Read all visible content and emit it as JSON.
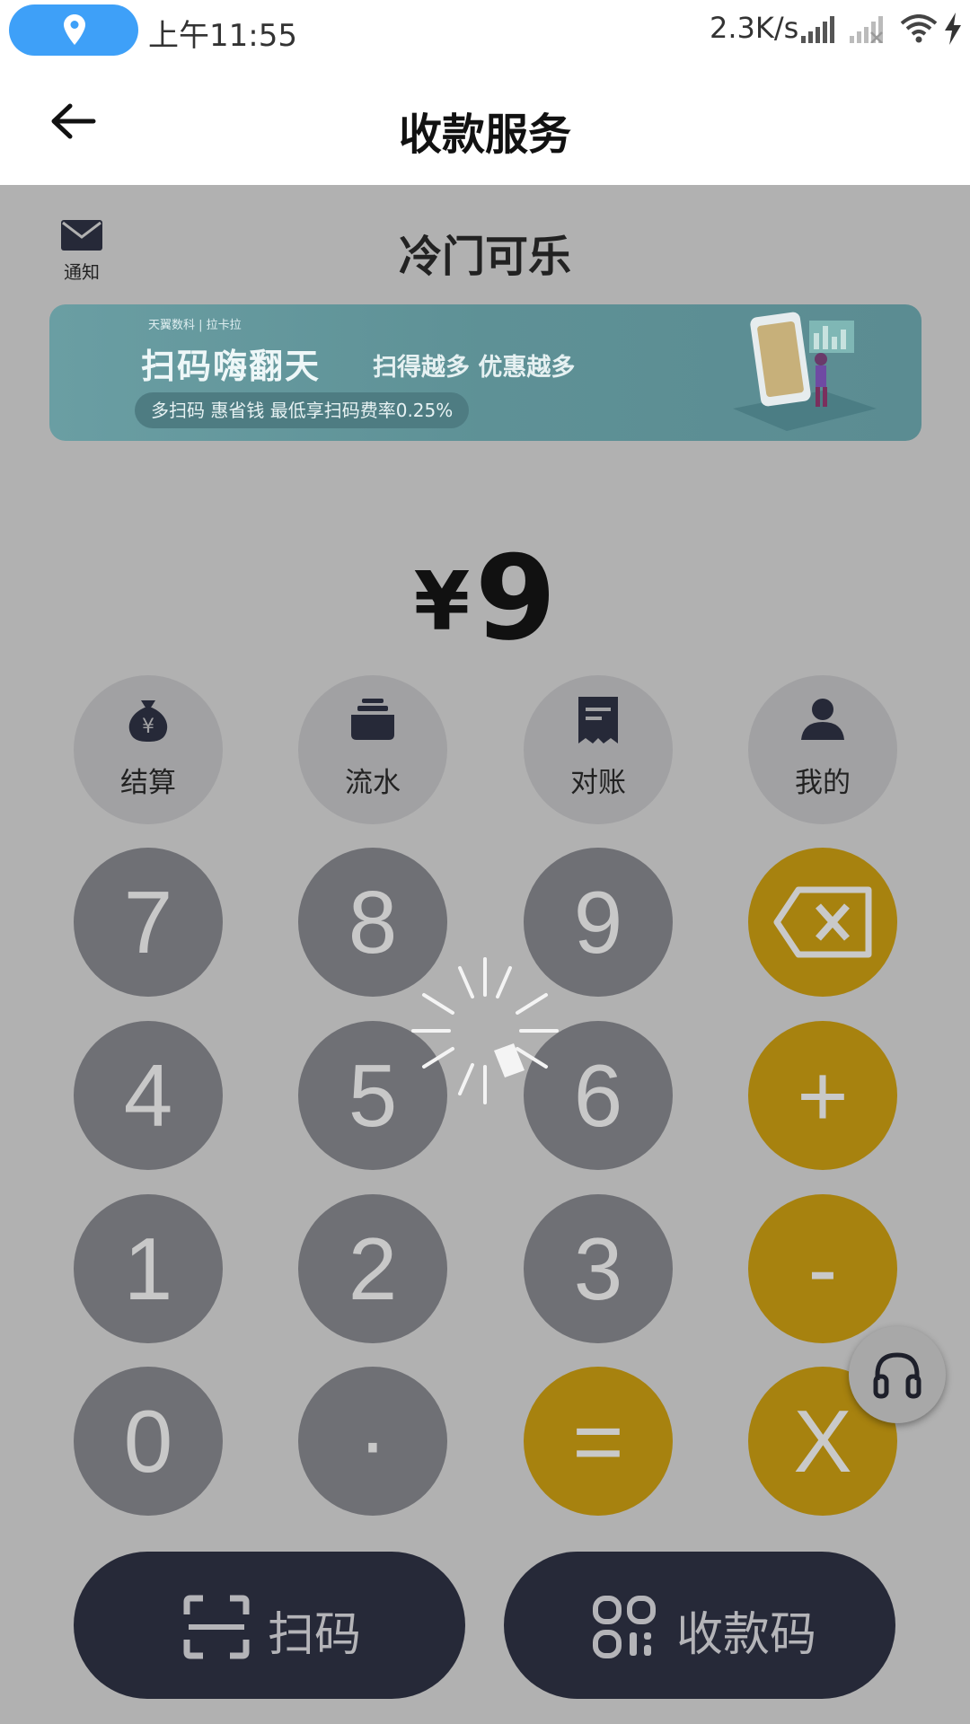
{
  "status_bar": {
    "time": "上午11:55",
    "net_speed": "2.3K/s",
    "icons": [
      "location-icon",
      "signal-icon",
      "signal-off-icon",
      "wifi-icon",
      "charging-icon"
    ]
  },
  "header": {
    "title": "收款服务",
    "back_icon": "arrow-left-icon"
  },
  "notify": {
    "label": "通知",
    "icon": "mail-icon"
  },
  "shop_name": "冷门可乐",
  "banner": {
    "brand": "天翼数科 | 拉卡拉",
    "title": "扫码嗨翻天",
    "subtitle": "扫得越多 优惠越多",
    "pill": "多扫码 惠省钱 最低享扫码费率0.25%"
  },
  "amount": {
    "currency": "¥",
    "value": "9"
  },
  "functions": [
    {
      "label": "结算",
      "icon": "money-bag-icon"
    },
    {
      "label": "流水",
      "icon": "stack-icon"
    },
    {
      "label": "对账",
      "icon": "receipt-icon"
    },
    {
      "label": "我的",
      "icon": "person-icon"
    }
  ],
  "keypad": {
    "digits": [
      "7",
      "8",
      "9",
      "4",
      "5",
      "6",
      "1",
      "2",
      "3",
      "0",
      "·"
    ],
    "ops": {
      "backspace": "backspace-icon",
      "plus": "+",
      "minus": "-",
      "equals": "=",
      "times": "X"
    }
  },
  "support_icon": "headset-icon",
  "actions": {
    "scan": "扫码",
    "qr": "收款码"
  },
  "colors": {
    "overlay_bg": "#b1b1b1",
    "digit_key": "#6f7075",
    "operator_key": "#a7820f",
    "action_button": "#262938",
    "location_pill": "#3ea0f8",
    "progress": "#5fd22a"
  }
}
